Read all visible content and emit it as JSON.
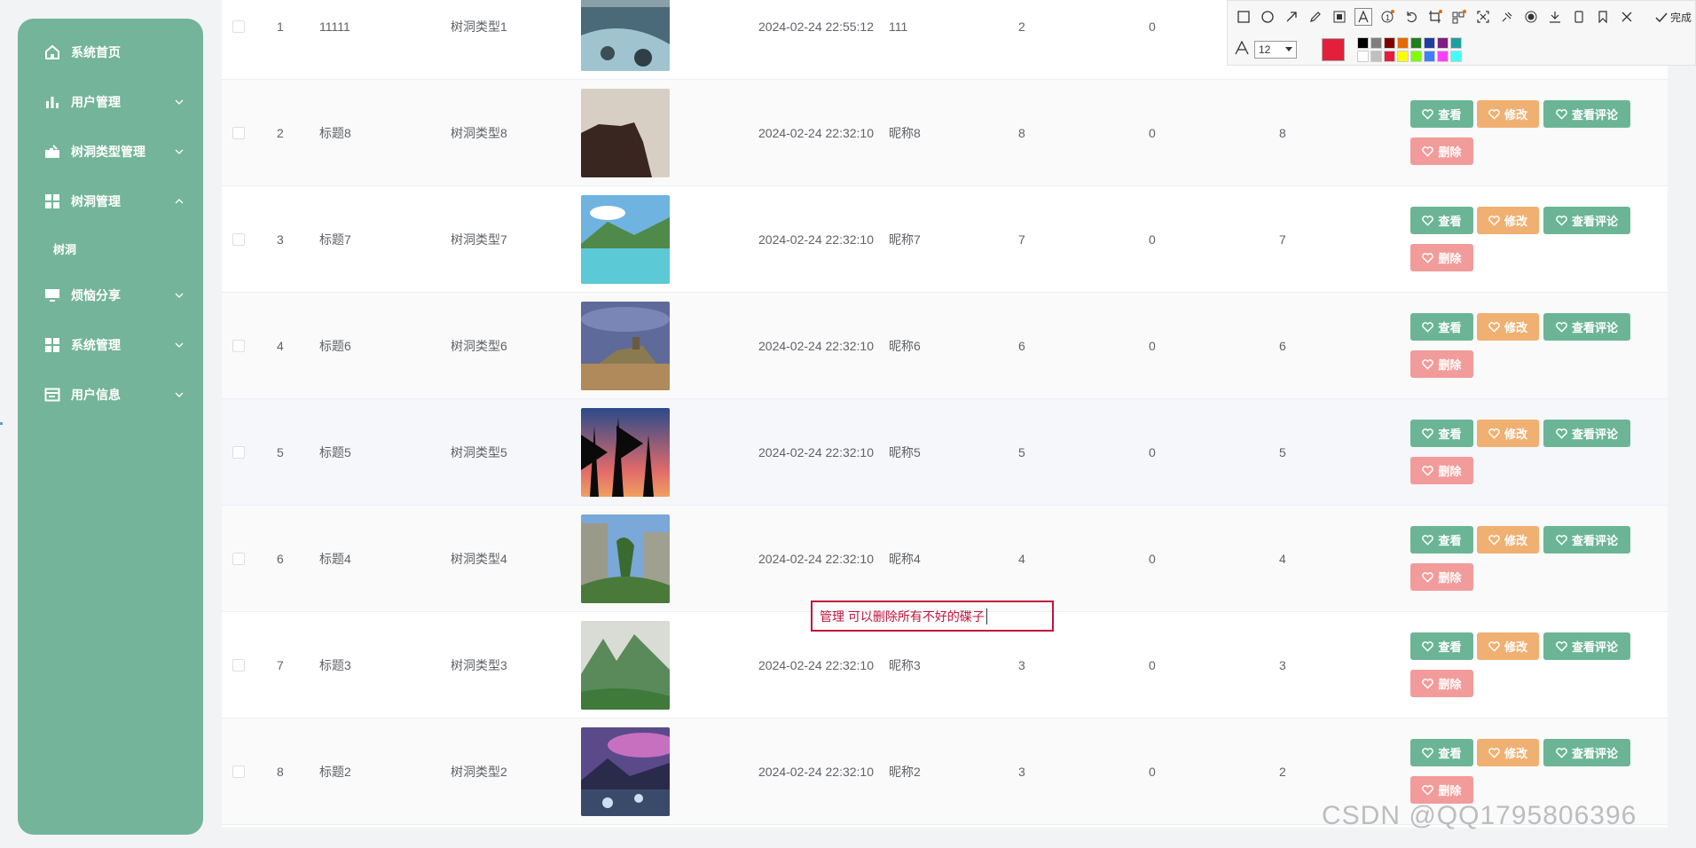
{
  "sidebar": {
    "items": [
      {
        "label": "系统首页",
        "icon": "home-icon"
      },
      {
        "label": "用户管理",
        "icon": "bar-chart-icon"
      },
      {
        "label": "树洞类型管理",
        "icon": "folder-icon"
      },
      {
        "label": "树洞管理",
        "icon": "grid-icon"
      },
      {
        "label": "烦恼分享",
        "icon": "monitor-icon"
      },
      {
        "label": "系统管理",
        "icon": "grid-icon"
      },
      {
        "label": "用户信息",
        "icon": "card-icon"
      }
    ],
    "submenu": {
      "label": "树洞"
    }
  },
  "table": {
    "rows": [
      {
        "idx": "1",
        "title": "11111",
        "type": "树洞类型1",
        "time": "2024-02-24 22:55:12",
        "nick": "111",
        "a": "2",
        "b": "0",
        "c": "",
        "image": "river"
      },
      {
        "idx": "2",
        "title": "标题8",
        "type": "树洞类型8",
        "time": "2024-02-24 22:32:10",
        "nick": "昵称8",
        "a": "8",
        "b": "0",
        "c": "8",
        "image": "cliff"
      },
      {
        "idx": "3",
        "title": "标题7",
        "type": "树洞类型7",
        "time": "2024-02-24 22:32:10",
        "nick": "昵称7",
        "a": "7",
        "b": "0",
        "c": "7",
        "image": "lake"
      },
      {
        "idx": "4",
        "title": "标题6",
        "type": "树洞类型6",
        "time": "2024-02-24 22:32:10",
        "nick": "昵称6",
        "a": "6",
        "b": "0",
        "c": "6",
        "image": "castle"
      },
      {
        "idx": "5",
        "title": "标题5",
        "type": "树洞类型5",
        "time": "2024-02-24 22:32:10",
        "nick": "昵称5",
        "a": "5",
        "b": "0",
        "c": "5",
        "image": "sunset"
      },
      {
        "idx": "6",
        "title": "标题4",
        "type": "树洞类型4",
        "time": "2024-02-24 22:32:10",
        "nick": "昵称4",
        "a": "4",
        "b": "0",
        "c": "4",
        "image": "rocks"
      },
      {
        "idx": "7",
        "title": "标题3",
        "type": "树洞类型3",
        "time": "2024-02-24 22:32:10",
        "nick": "昵称3",
        "a": "3",
        "b": "0",
        "c": "3",
        "image": "mountain"
      },
      {
        "idx": "8",
        "title": "标题2",
        "type": "树洞类型2",
        "time": "2024-02-24 22:32:10",
        "nick": "昵称2",
        "a": "3",
        "b": "0",
        "c": "2",
        "image": "night"
      }
    ],
    "buttons": {
      "view": "查看",
      "edit": "修改",
      "comments": "查看评论",
      "delete": "删除"
    }
  },
  "annotation": {
    "done_label": "完成",
    "font_size": "12",
    "current_color": "#e31f3c",
    "palette": [
      "#000000",
      "#7f7f7f",
      "#7f0000",
      "#e36c09",
      "#1f7f1f",
      "#1f3f9f",
      "#7f1f7f",
      "#1f9f9f",
      "#ffffff",
      "#c0c0c0",
      "#e31f3c",
      "#ffff00",
      "#7fff00",
      "#3f7fff",
      "#ff3fff",
      "#3fffff"
    ],
    "note_text": "管理 可以删除所有不好的碟子"
  },
  "watermark": "CSDN @QQ1795806396",
  "colors": {
    "sidebar": "#73b49a",
    "view": "#6bb596",
    "edit": "#f0b071",
    "delete": "#f29b9b"
  }
}
